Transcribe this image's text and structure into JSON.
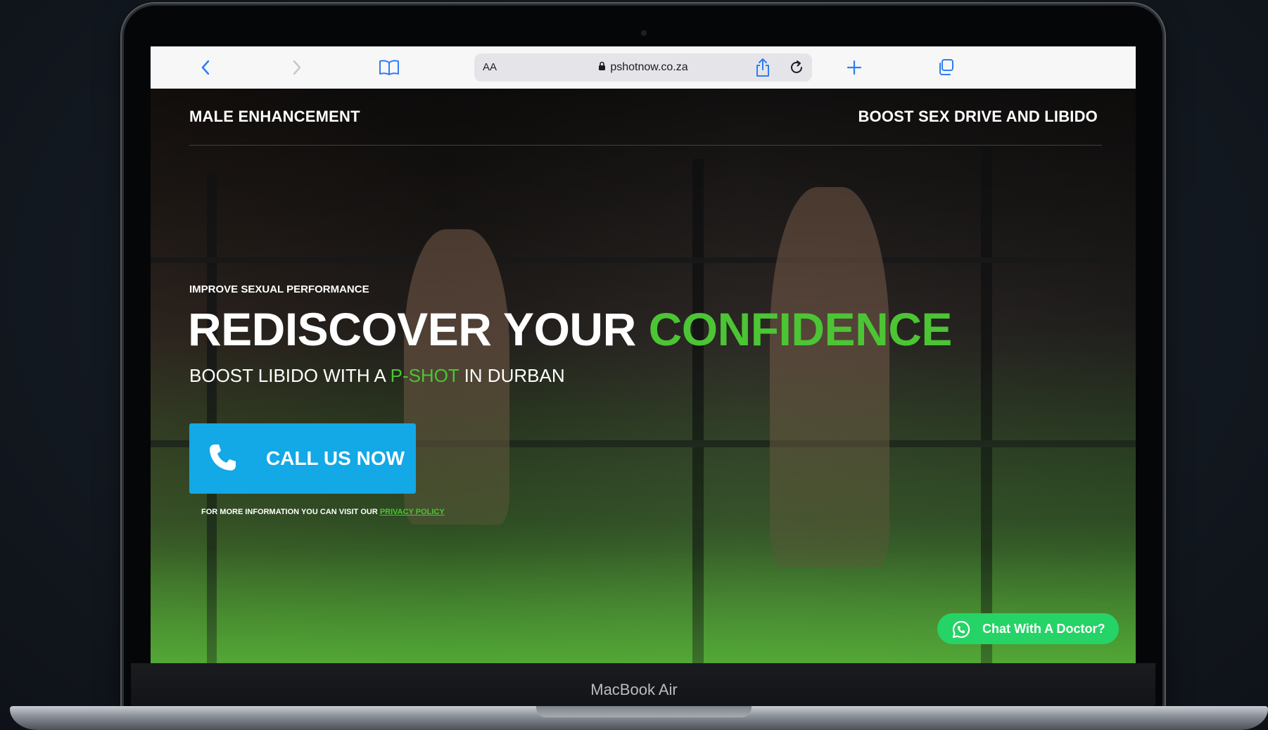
{
  "browser": {
    "url": "pshotnow.co.za",
    "text_size_label": "AA"
  },
  "nav": {
    "left_label": "MALE ENHANCEMENT",
    "right_label": "BOOST SEX DRIVE AND LIBIDO"
  },
  "hero": {
    "eyebrow": "IMPROVE SEXUAL PERFORMANCE",
    "headline_part1": "REDISCOVER YOUR ",
    "headline_highlight": "CONFIDENCE",
    "subhead_part1": "BOOST LIBIDO WITH A ",
    "subhead_highlight": "P-SHOT",
    "subhead_part2": " IN DURBAN",
    "cta_label": "CALL US NOW",
    "fine_print": "FOR MORE INFORMATION YOU CAN VISIT OUR ",
    "fine_print_link": "PRIVACY POLICY",
    "chat_label": "Chat With A Doctor?"
  },
  "device": {
    "model_label": "MacBook Air"
  },
  "colors": {
    "accent_green": "#4cc534",
    "cta_blue": "#13a8e6",
    "whatsapp_green": "#25d366"
  },
  "icons": {
    "back": "chevron-left-icon",
    "forward": "chevron-right-icon",
    "bookmarks": "book-icon",
    "lock": "lock-icon",
    "reload": "reload-icon",
    "share": "share-icon",
    "new_tab": "plus-icon",
    "tabs": "tabs-icon",
    "phone": "phone-icon",
    "whatsapp": "whatsapp-icon"
  }
}
